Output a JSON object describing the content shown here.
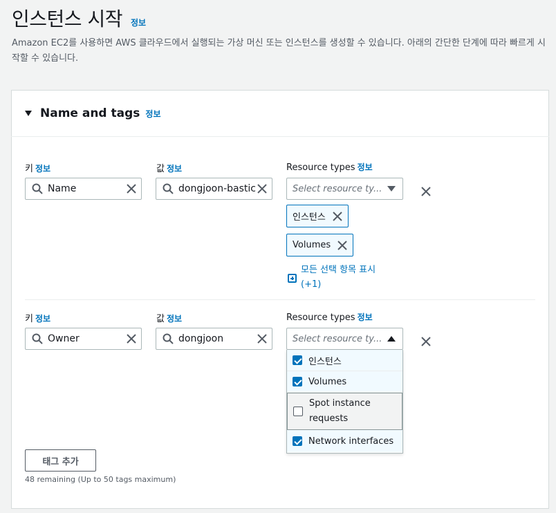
{
  "header": {
    "title": "인스턴스 시작",
    "info": "정보",
    "description": "Amazon EC2를 사용하면 AWS 클라우드에서 실행되는 가상 머신 또는 인스턴스를 생성할 수 있습니다. 아래의 간단한 단계에 따라 빠르게 시작할 수 있습니다."
  },
  "panel": {
    "title": "Name and tags",
    "info": "정보"
  },
  "labels": {
    "key": "키",
    "value": "값",
    "resource_types": "Resource types",
    "info": "정보"
  },
  "tags": [
    {
      "key": "Name",
      "value": "dongjoon-bastic",
      "resource_placeholder": "Select resource ty...",
      "tokens": [
        "인스턴스",
        "Volumes"
      ],
      "show_more": "모든 선택 항목 표시",
      "show_more_count": "(+1)"
    },
    {
      "key": "Owner",
      "value": "dongjoon",
      "resource_placeholder": "Select resource ty...",
      "dropdown_open": true,
      "options": [
        {
          "label": "인스턴스",
          "checked": true
        },
        {
          "label": "Volumes",
          "checked": true
        },
        {
          "label": "Spot instance requests",
          "checked": false
        },
        {
          "label": "Network interfaces",
          "checked": true
        }
      ]
    }
  ],
  "footer": {
    "add_tag": "태그 추가",
    "remaining": "48 remaining (Up to 50 tags maximum)"
  },
  "colors": {
    "link": "#0073bb",
    "checkbox": "#0073bb",
    "background": "#f2f3f3"
  }
}
